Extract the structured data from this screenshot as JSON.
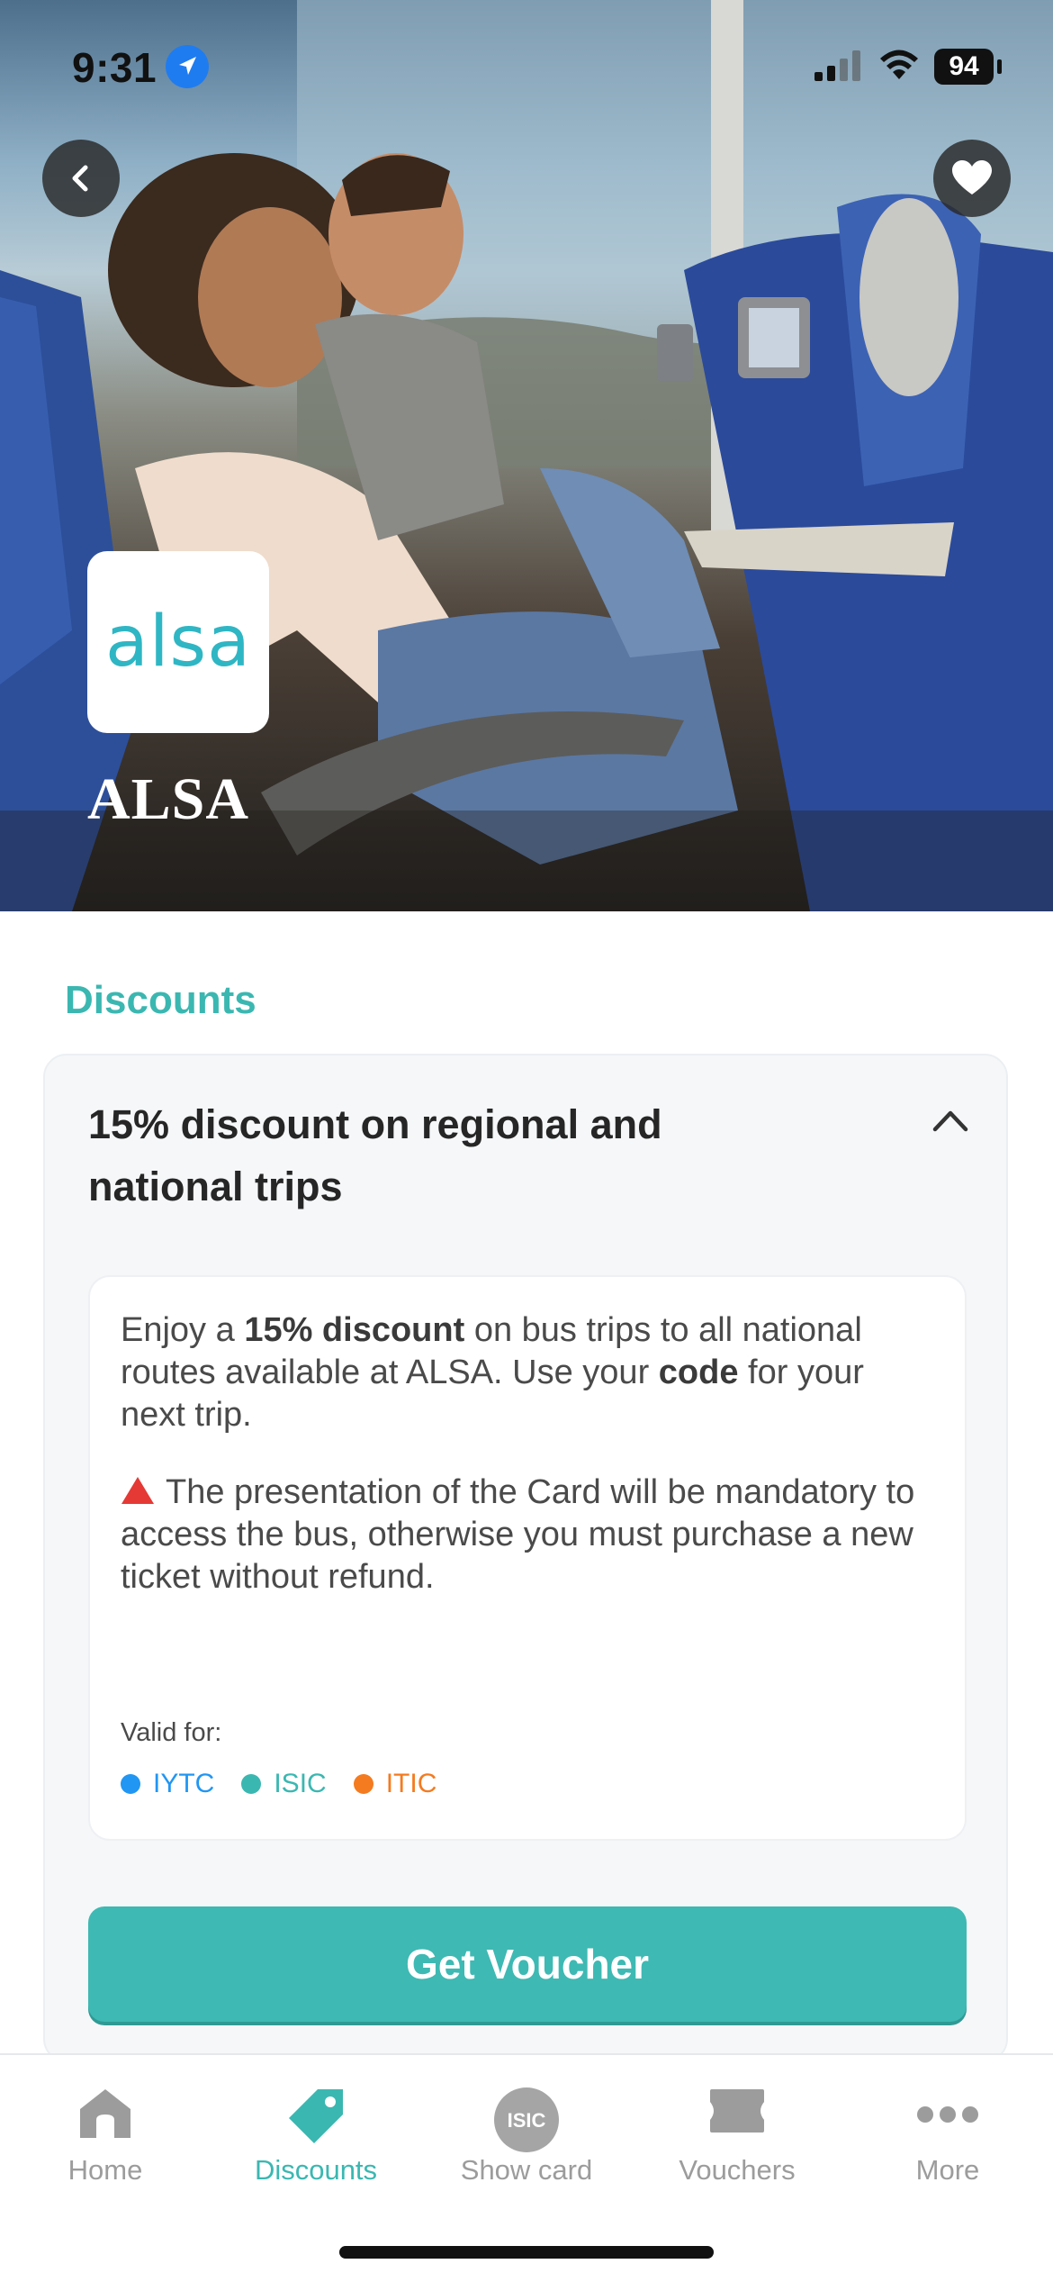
{
  "status_bar": {
    "time": "9:31",
    "battery": "94"
  },
  "hero": {
    "logo_text": "alsa",
    "brand_name": "ALSA"
  },
  "discounts": {
    "section_title": "Discounts",
    "offer": {
      "title": "15% discount on regional and national trips",
      "desc_prefix": "Enjoy a ",
      "desc_bold1": "15% discount",
      "desc_mid": " on bus trips to all national routes available at ALSA. Use your ",
      "desc_bold2": "code",
      "desc_suffix": " for your next trip.",
      "warning": "The presentation of the Card will be mandatory to access the bus, otherwise you must purchase a new ticket without refund.",
      "valid_label": "Valid for:",
      "valid_for": [
        {
          "name": "IYTC",
          "color": "#2196f3"
        },
        {
          "name": "ISIC",
          "color": "#3bb7b1"
        },
        {
          "name": "ITIC",
          "color": "#f47b20"
        }
      ],
      "button_label": "Get Voucher"
    }
  },
  "tabbar": {
    "active": "Discounts",
    "tabs": [
      {
        "label": "Home",
        "icon": "home-icon"
      },
      {
        "label": "Discounts",
        "icon": "tag-icon"
      },
      {
        "label": "Show card",
        "icon": "isic-card-icon",
        "icon_text": "ISIC"
      },
      {
        "label": "Vouchers",
        "icon": "ticket-icon"
      },
      {
        "label": "More",
        "icon": "more-dots-icon"
      }
    ]
  },
  "colors": {
    "accent": "#3bb7b1",
    "accent_button": "#3eb9b3",
    "warning": "#e53935"
  }
}
